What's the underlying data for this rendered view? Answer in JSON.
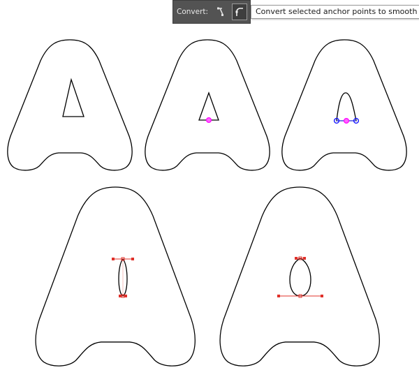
{
  "toolbar": {
    "convert_label": "Convert:",
    "tools": [
      {
        "name": "convert-to-corner",
        "icon": "corner-anchor-icon",
        "active": false
      },
      {
        "name": "convert-to-smooth",
        "icon": "smooth-anchor-icon",
        "active": true
      }
    ]
  },
  "tooltip": {
    "text": "Convert selected anchor points to smooth"
  },
  "colors": {
    "panel": "#535353",
    "anchor_magenta": "#ff00ff",
    "anchor_blue": "#1a1aff",
    "handle_red": "#e0302a",
    "outline": "#000000"
  },
  "steps": [
    {
      "id": "step-1",
      "state": "triangle-counter"
    },
    {
      "id": "step-2",
      "state": "bottom-anchor-selected"
    },
    {
      "id": "step-3",
      "state": "anchors-added"
    },
    {
      "id": "step-4",
      "state": "smoothed-narrow"
    },
    {
      "id": "step-5",
      "state": "smoothed-rounded"
    }
  ]
}
